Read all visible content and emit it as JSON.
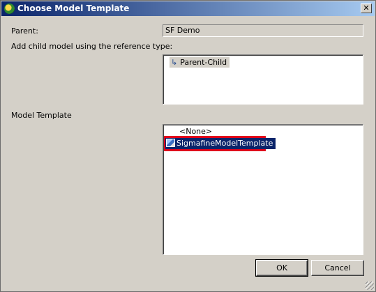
{
  "window": {
    "title": "Choose Model Template",
    "close_glyph": "✕",
    "app_icon": "app-logo-icon"
  },
  "form": {
    "parent_label": "Parent:",
    "parent_value": "SF Demo",
    "reference_label": "Add child model using the reference type:",
    "reference_types": [
      {
        "label": "Parent-Child",
        "icon": "arrow-reference-icon",
        "arrow": "↳",
        "selected": true
      }
    ],
    "template_label": "Model Template",
    "templates": [
      {
        "label": "<None>",
        "selected": false
      },
      {
        "label": "SigmafineModelTemplate",
        "icon": "model-template-icon",
        "selected": true,
        "highlighted": true
      }
    ]
  },
  "buttons": {
    "ok": "OK",
    "cancel": "Cancel"
  },
  "colors": {
    "dialog_bg": "#d4d0c8",
    "title_start": "#0a246a",
    "title_end": "#a6caf0",
    "selection": "#0a246a",
    "highlight": "#e0001b"
  }
}
